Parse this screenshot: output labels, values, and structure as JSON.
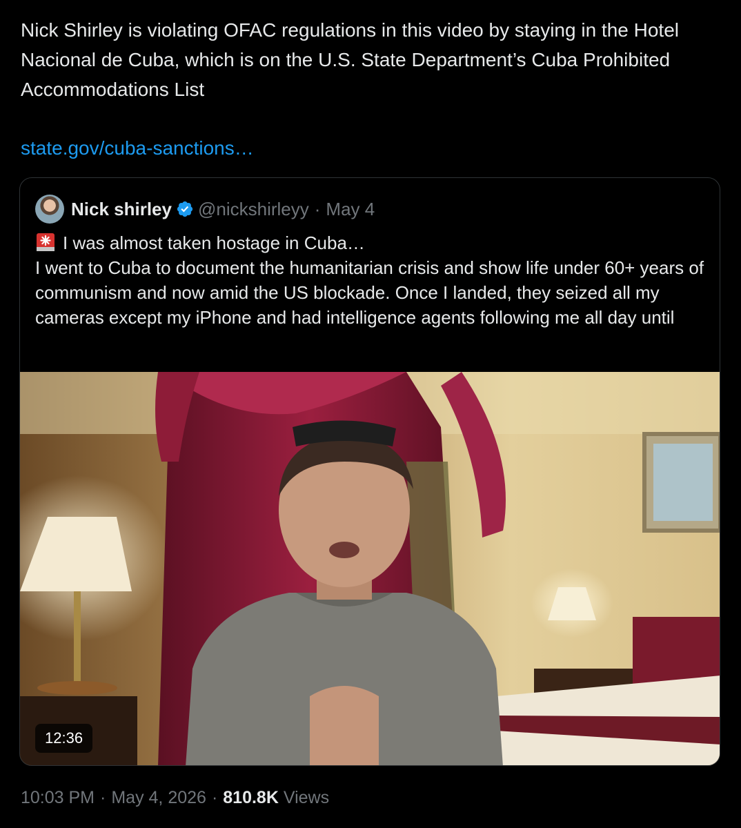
{
  "tweet": {
    "text": "Nick Shirley is violating OFAC regulations in this video by staying in the Hotel Nacional de Cuba, which is on the U.S. State Department’s Cuba Prohibited Accommodations List",
    "link": "state.gov/cuba-sanctions…"
  },
  "quote": {
    "author_name": "Nick shirley",
    "author_handle": "@nickshirleyy",
    "separator": "·",
    "date": "May 4",
    "verified_icon": "verified-badge-icon",
    "siren_icon": "rotating-light-emoji",
    "headline": "I was almost taken hostage in Cuba…",
    "body": "I went to Cuba to document the humanitarian crisis and show life under 60+ years of communism and now amid the US blockade. Once I landed, they seized all my cameras except my iPhone and had intelligence agents following me all day until",
    "video": {
      "duration": "12:36"
    }
  },
  "meta": {
    "time": "10:03 PM",
    "separator": "·",
    "date": "May 4, 2026",
    "views_count": "810.8K",
    "views_label": "Views"
  },
  "colors": {
    "background": "#000000",
    "text": "#e7e9ea",
    "secondary": "#71767b",
    "link": "#1d9bf0",
    "verified": "#1d9bf0",
    "border": "#2f3336"
  }
}
